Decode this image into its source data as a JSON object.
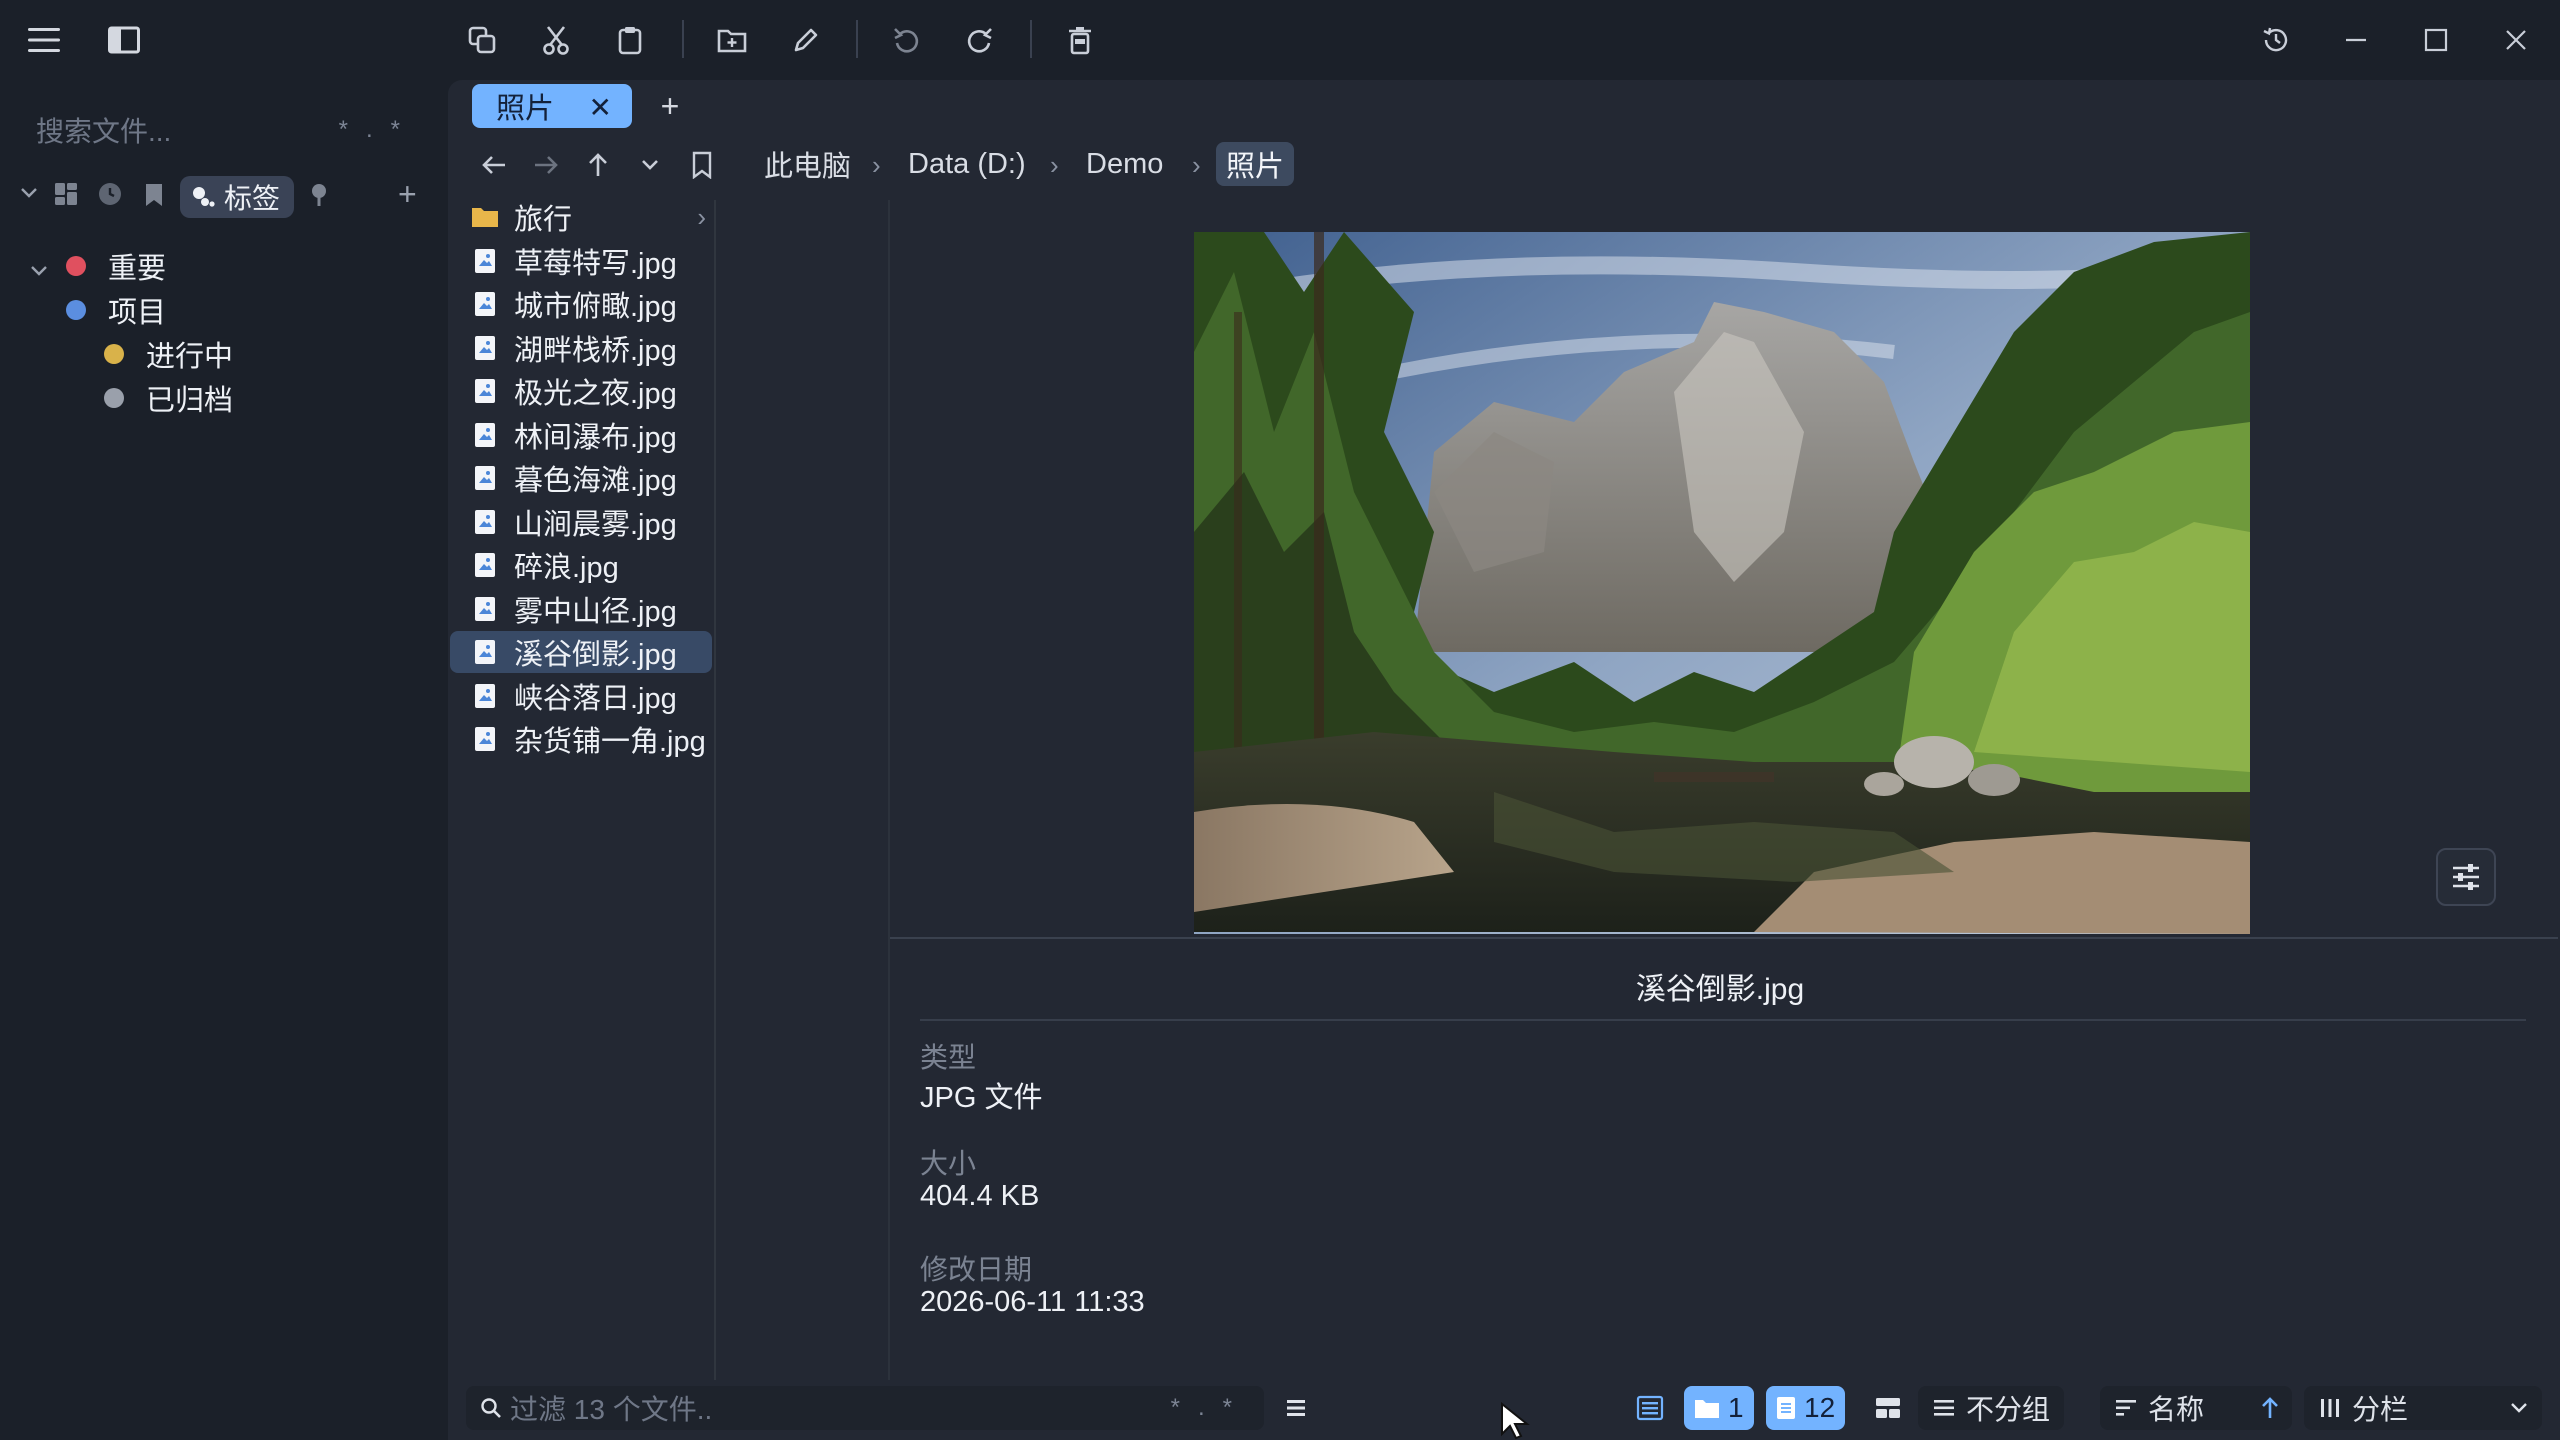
{
  "app": {
    "colors": {
      "accent": "#73b3ff",
      "bg": "#1b2029",
      "panel": "#232833",
      "selection": "#384a66"
    },
    "toolbar_icons": [
      "menu-icon",
      "sidebar-toggle-icon",
      "copy-icon",
      "cut-icon",
      "paste-icon",
      "new-folder-icon",
      "rename-icon",
      "undo-icon",
      "redo-icon",
      "delete-icon",
      "history-icon",
      "minimize-icon",
      "maximize-icon",
      "close-icon"
    ]
  },
  "sidebar": {
    "search_placeholder": "搜索文件...",
    "search_mod_wildcard": "*",
    "search_mod_regex": ".*",
    "tag_tab_label": "标签",
    "tags": [
      {
        "label": "重要",
        "color": "#e0505f"
      },
      {
        "label": "项目",
        "color": "#5b8ee0"
      },
      {
        "label": "进行中",
        "color": "#d9b24a"
      },
      {
        "label": "已归档",
        "color": "#9aa0ab"
      }
    ]
  },
  "tabs": [
    {
      "label": "照片",
      "active": true
    }
  ],
  "breadcrumb": [
    "此电脑",
    "Data (D:)",
    "Demo",
    "照片"
  ],
  "files": [
    {
      "name": "旅行",
      "kind": "folder"
    },
    {
      "name": "草莓特写.jpg",
      "kind": "image"
    },
    {
      "name": "城市俯瞰.jpg",
      "kind": "image"
    },
    {
      "name": "湖畔栈桥.jpg",
      "kind": "image"
    },
    {
      "name": "极光之夜.jpg",
      "kind": "image"
    },
    {
      "name": "林间瀑布.jpg",
      "kind": "image"
    },
    {
      "name": "暮色海滩.jpg",
      "kind": "image"
    },
    {
      "name": "山涧晨雾.jpg",
      "kind": "image"
    },
    {
      "name": "碎浪.jpg",
      "kind": "image"
    },
    {
      "name": "雾中山径.jpg",
      "kind": "image"
    },
    {
      "name": "溪谷倒影.jpg",
      "kind": "image",
      "selected": true
    },
    {
      "name": "峡谷落日.jpg",
      "kind": "image"
    },
    {
      "name": "杂货铺一角.jpg",
      "kind": "image"
    }
  ],
  "preview": {
    "filename": "溪谷倒影.jpg",
    "type_label": "类型",
    "type_value": "JPG 文件",
    "size_label": "大小",
    "size_value": "404.4 KB",
    "modified_label": "修改日期",
    "modified_value": "2026-06-11 11:33"
  },
  "statusbar": {
    "filter_placeholder": "过滤 13 个文件..",
    "filter_mod_wildcard": "*",
    "filter_mod_regex": ".*",
    "folder_count": "1",
    "file_count": "12",
    "group_label": "不分组",
    "sort_label": "名称",
    "layout_label": "分栏"
  }
}
